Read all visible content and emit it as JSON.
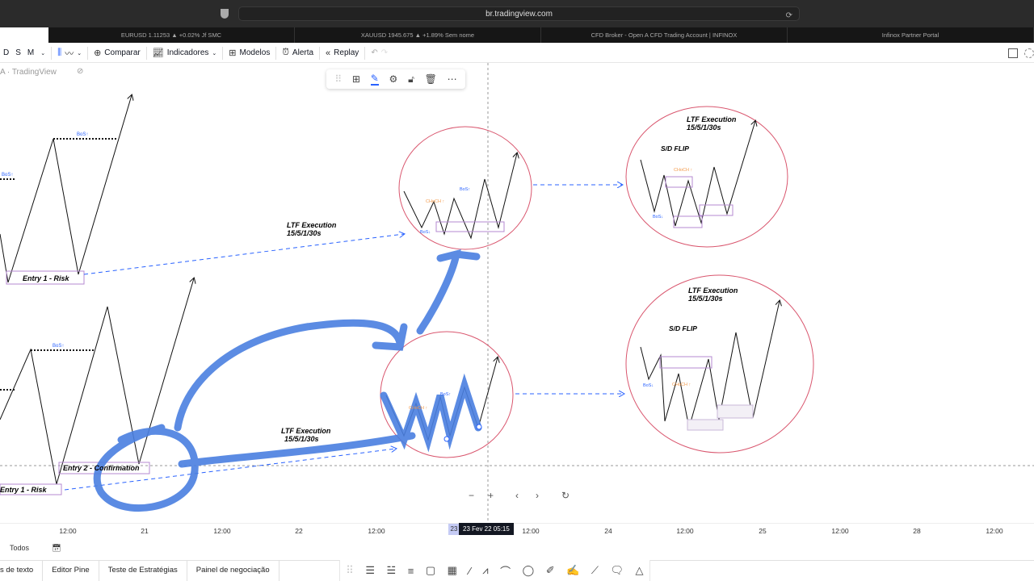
{
  "browser": {
    "url": "br.tradingview.com",
    "tabs": [
      "EURUSD 1.11253 ▲ +0.02% Jf SMC",
      "XAUUSD 1945.675 ▲ +1.89% Sem nome",
      "CFD Broker - Open A CFD Trading Account | INFINOX",
      "Infinox Partner Portal"
    ]
  },
  "toolbar": {
    "intervals": [
      "D",
      "S",
      "M"
    ],
    "compare": "Comparar",
    "indicators": "Indicadores",
    "templates": "Modelos",
    "alert": "Alerta",
    "replay": "Replay"
  },
  "watermark": "A · TradingView",
  "annotations": {
    "bos_up": "BoS↑",
    "bos_down": "BoS↓",
    "choch_up": "CHoCH ↑",
    "entry1": "Entry 1 - Risk",
    "entry2": "Entry 2 - Confirmation",
    "ltf": "LTF Execution",
    "tf": "15/5/1/30s",
    "sd_flip": "S/D FLIP"
  },
  "colors": {
    "accent": "#2962ff",
    "scribble": "#4a7fe0",
    "circle": "#d9566e",
    "zone": "#b48ad0",
    "choch": "#f2994a"
  },
  "time_axis": [
    "12:00",
    "21",
    "12:00",
    "22",
    "12:00",
    "12:00",
    "24",
    "12:00",
    "25",
    "12:00",
    "28",
    "12:00"
  ],
  "crosshair": {
    "day": "23",
    "label": "23 Fev 22  05:15"
  },
  "range": {
    "all": "Todos"
  },
  "bottom_tabs": [
    "s de texto",
    "Editor Pine",
    "Teste de Estratégias",
    "Painel de negociação"
  ]
}
